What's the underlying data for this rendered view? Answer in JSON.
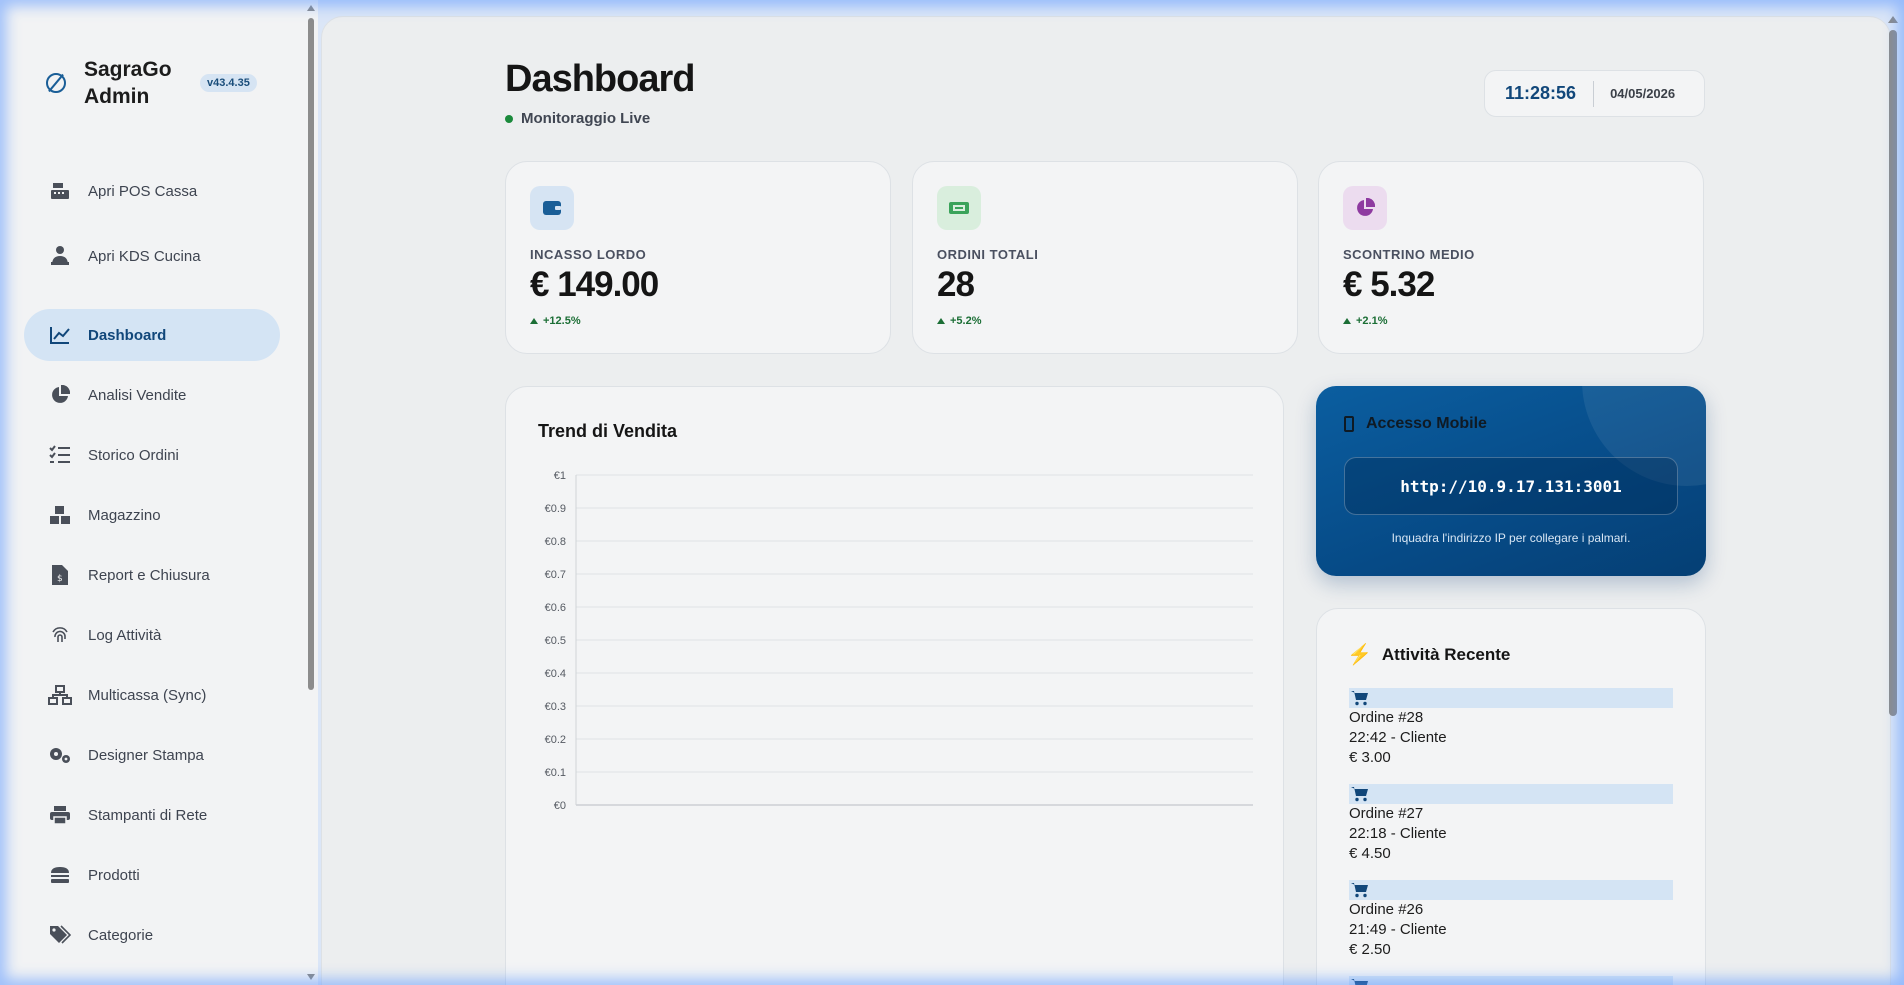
{
  "brand": {
    "name": "SagraGo Admin",
    "version": "v43.4.35"
  },
  "sidebar": {
    "items": [
      {
        "label": "Apri POS Cassa",
        "icon": "cash-register-icon",
        "active": false
      },
      {
        "label": "Apri KDS Cucina",
        "icon": "chef-icon",
        "active": false
      },
      {
        "label": "Dashboard",
        "icon": "line-chart-icon",
        "active": true
      },
      {
        "label": "Analisi Vendite",
        "icon": "pie-chart-icon",
        "active": false
      },
      {
        "label": "Storico Ordini",
        "icon": "checklist-icon",
        "active": false
      },
      {
        "label": "Magazzino",
        "icon": "boxes-icon",
        "active": false
      },
      {
        "label": "Report e Chiusura",
        "icon": "invoice-icon",
        "active": false
      },
      {
        "label": "Log Attività",
        "icon": "fingerprint-icon",
        "active": false
      },
      {
        "label": "Multicassa (Sync)",
        "icon": "network-icon",
        "active": false
      },
      {
        "label": "Designer Stampa",
        "icon": "gears-icon",
        "active": false
      },
      {
        "label": "Stampanti di Rete",
        "icon": "printer-icon",
        "active": false
      },
      {
        "label": "Prodotti",
        "icon": "burger-icon",
        "active": false
      },
      {
        "label": "Categorie",
        "icon": "tags-icon",
        "active": false
      }
    ]
  },
  "header": {
    "title": "Dashboard",
    "status": "Monitoraggio Live",
    "time": "11:28:56",
    "date": "04/05/2026"
  },
  "stats": [
    {
      "label": "INCASSO LORDO",
      "value": "€ 149.00",
      "trend": "+12.5%",
      "icon": "wallet-icon",
      "icon_color": "#1a5e97",
      "icon_bg": "#d6e4f3"
    },
    {
      "label": "ORDINI TOTALI",
      "value": "28",
      "trend": "+5.2%",
      "icon": "ticket-icon",
      "icon_color": "#3aa35a",
      "icon_bg": "#d9eedd"
    },
    {
      "label": "SCONTRINO MEDIO",
      "value": "€ 5.32",
      "trend": "+2.1%",
      "icon": "pie-chart-icon",
      "icon_color": "#8e3aa0",
      "icon_bg": "#ecdcef"
    }
  ],
  "chart_data": {
    "type": "line",
    "title": "Trend di Vendita",
    "y_ticks": [
      "€1",
      "€0.9",
      "€0.8",
      "€0.7",
      "€0.6",
      "€0.5",
      "€0.4",
      "€0.3",
      "€0.2",
      "€0.1",
      "€0"
    ],
    "ylim": [
      0,
      1
    ],
    "series": [],
    "grid": true
  },
  "mobile": {
    "title": "Accesso Mobile",
    "url": "http://10.9.17.131:3001",
    "hint": "Inquadra l'indirizzo IP per collegare i palmari."
  },
  "activity": {
    "title": "Attività Recente",
    "items": [
      {
        "order": "Ordine #28",
        "meta": "22:42 - Cliente",
        "amount": "€ 3.00"
      },
      {
        "order": "Ordine #27",
        "meta": "22:18 - Cliente",
        "amount": "€ 4.50"
      },
      {
        "order": "Ordine #26",
        "meta": "21:49 - Cliente",
        "amount": "€ 2.50"
      }
    ]
  }
}
